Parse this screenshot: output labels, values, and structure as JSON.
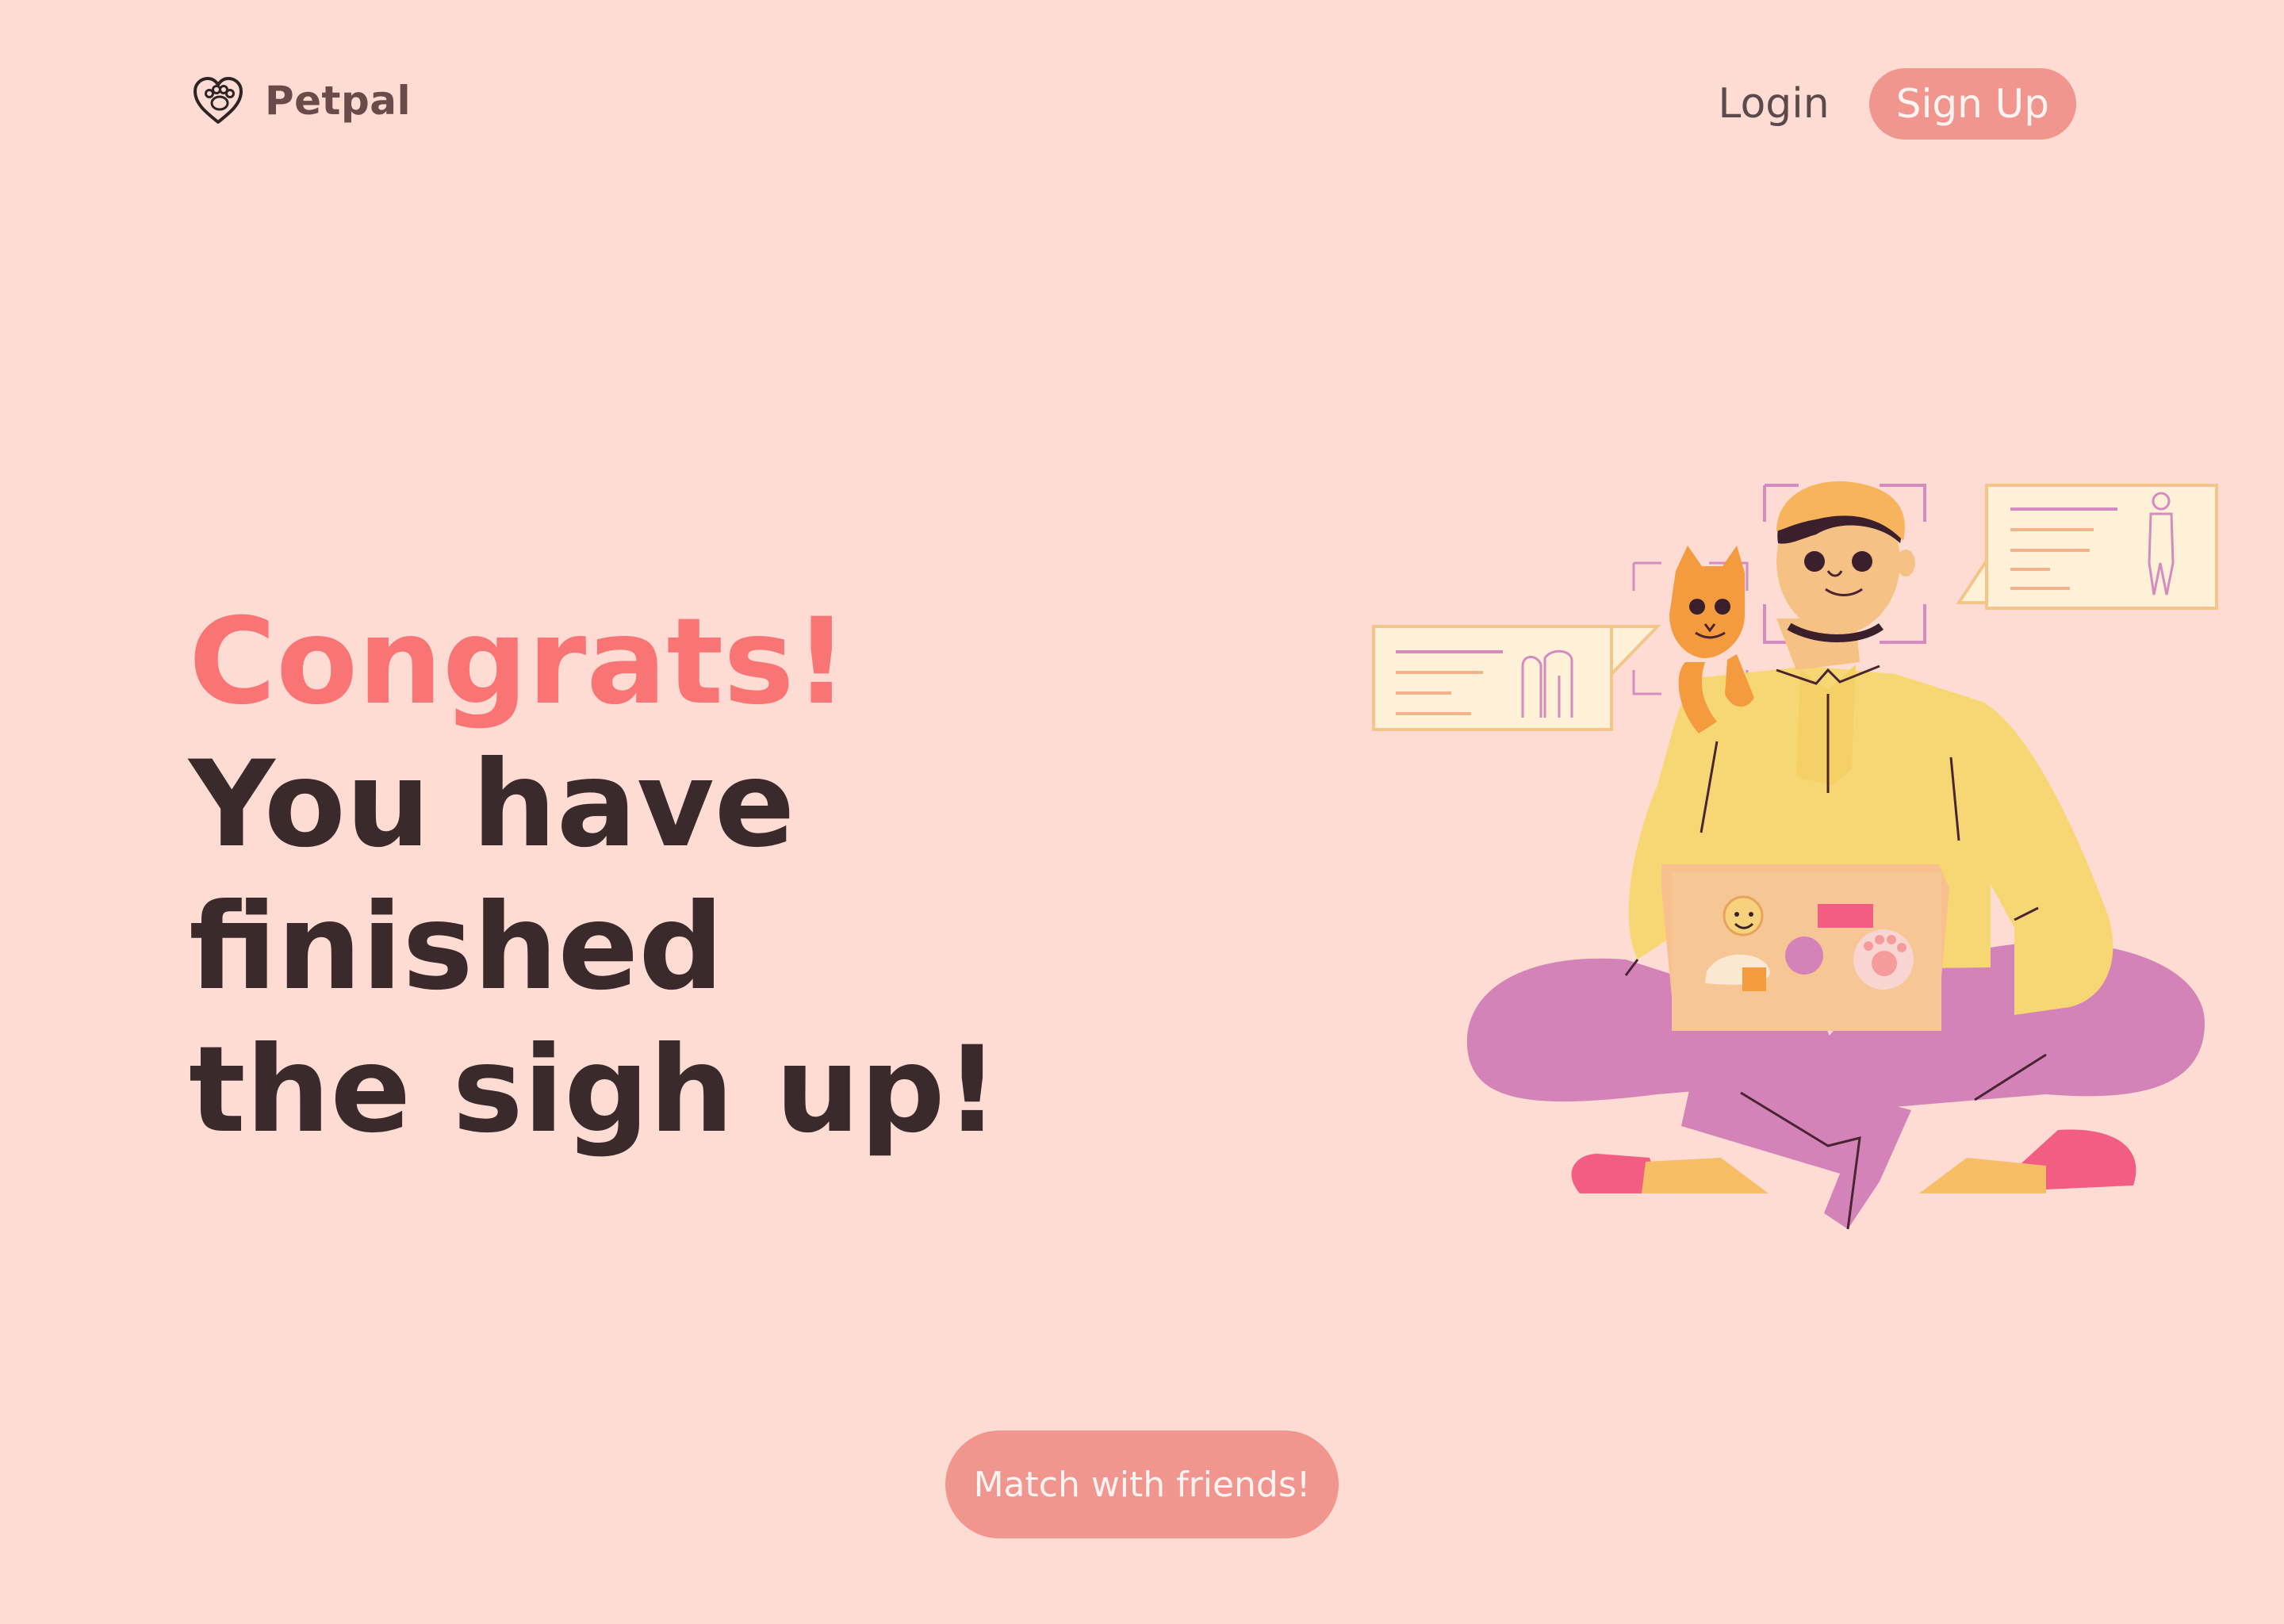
{
  "header": {
    "brand_name": "Petpal",
    "nav": {
      "login_label": "Login",
      "signup_label": "Sign Up"
    }
  },
  "hero": {
    "accent_title": "Congrats!",
    "title": "You have finished\nthe sigh up!"
  },
  "cta": {
    "label": "Match with friends!"
  },
  "icons": {
    "brand": "paw-heart-icon"
  },
  "colors": {
    "background": "#FFDCD3",
    "accent": "#F97474",
    "button": "#F1968E",
    "text": "#3B2A2C"
  }
}
